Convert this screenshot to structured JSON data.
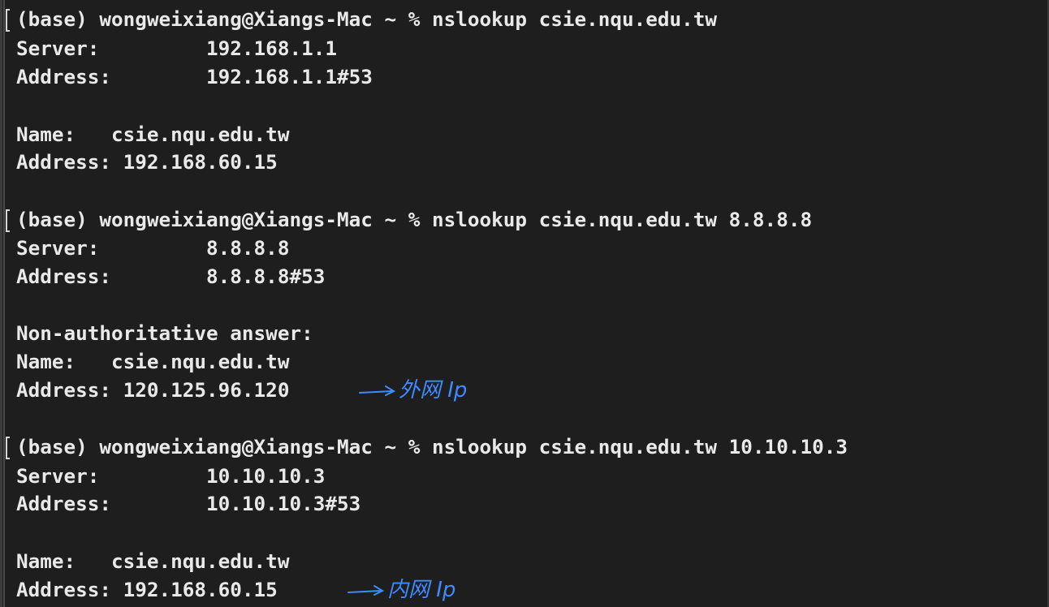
{
  "terminal": {
    "lines": [
      "(base) wongweixiang@Xiangs-Mac ~ % nslookup csie.nqu.edu.tw",
      "Server:\t\t192.168.1.1",
      "Address:\t192.168.1.1#53",
      "",
      "Name:\tcsie.nqu.edu.tw",
      "Address: 192.168.60.15",
      "",
      "(base) wongweixiang@Xiangs-Mac ~ % nslookup csie.nqu.edu.tw 8.8.8.8",
      "Server:\t\t8.8.8.8",
      "Address:\t8.8.8.8#53",
      "",
      "Non-authoritative answer:",
      "Name:\tcsie.nqu.edu.tw",
      "Address: 120.125.96.120",
      "",
      "(base) wongweixiang@Xiangs-Mac ~ % nslookup csie.nqu.edu.tw 10.10.10.3",
      "Server:\t\t10.10.10.3",
      "Address:\t10.10.10.3#53",
      "",
      "Name:\tcsie.nqu.edu.tw",
      "Address: 192.168.60.15"
    ],
    "annotations": {
      "external": "外网 Ip",
      "internal": "内网 Ip"
    },
    "colors": {
      "background": "#1e1e1e",
      "text": "#e9e9e9",
      "annotation": "#3d8bff"
    }
  }
}
